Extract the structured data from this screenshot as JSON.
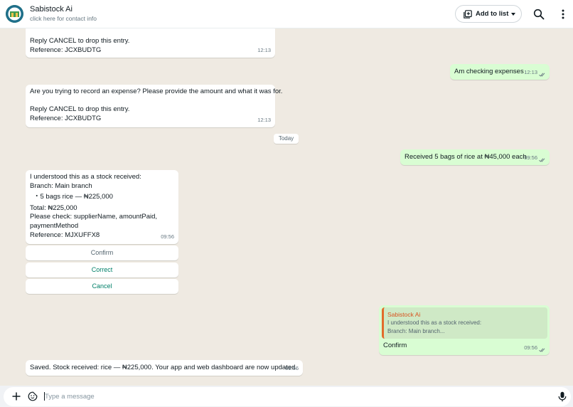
{
  "header": {
    "contact_name": "Sabistock Ai",
    "contact_sub": "click here for contact info",
    "add_to_list_label": "Add to list",
    "icons": [
      "avatar",
      "add-list-icon",
      "search-icon",
      "more-vert-icon"
    ]
  },
  "messages": [
    {
      "dir": "in",
      "lines": [
        "Reply CANCEL to drop this entry.",
        "Reference: JCXBUDTG"
      ],
      "time": "12:13"
    },
    {
      "dir": "out",
      "lines": [
        "Am checking expenses"
      ],
      "time": "12:13"
    },
    {
      "dir": "in",
      "lines": [
        "Are you trying to record an expense? Please provide the amount and what it was for.",
        "",
        "Reply CANCEL to drop this entry.",
        "Reference: JCXBUDTG"
      ],
      "time": "12:13"
    },
    {
      "dir": "out",
      "lines": [
        "Received 5 bags of rice at ₦45,000 each"
      ],
      "time": "09:56"
    },
    {
      "dir": "in",
      "lines": [
        "I understood this as a stock received:",
        "Branch: Main branch",
        "・5 bags rice — ₦225,000",
        "Total: ₦225,000",
        "Please check: supplierName, amountPaid,",
        "paymentMethod",
        "Reference: MJXUFFX8"
      ],
      "time": "09:56"
    },
    {
      "dir": "out",
      "quote_name": "Sabistock Ai",
      "quote_lines": [
        "I understood this as a stock received:",
        "Branch: Main branch..."
      ],
      "lines": [
        "Confirm"
      ],
      "time": "09:56"
    },
    {
      "dir": "in",
      "lines": [
        "Saved. Stock received: rice — ₦225,000. Your app and web dashboard are now updated."
      ],
      "time": "09:56"
    }
  ],
  "date_divider": "Today",
  "quick_replies": [
    "Confirm",
    "Correct",
    "Cancel"
  ],
  "composer": {
    "placeholder": "Type a message"
  },
  "colors": {
    "incoming": "#ffffff",
    "outgoing": "#d9fdd3",
    "chat_bg": "#efeae2",
    "accent_green": "#008069",
    "quote_name": "#d9531e",
    "tick_blue": "#53bdeb"
  }
}
